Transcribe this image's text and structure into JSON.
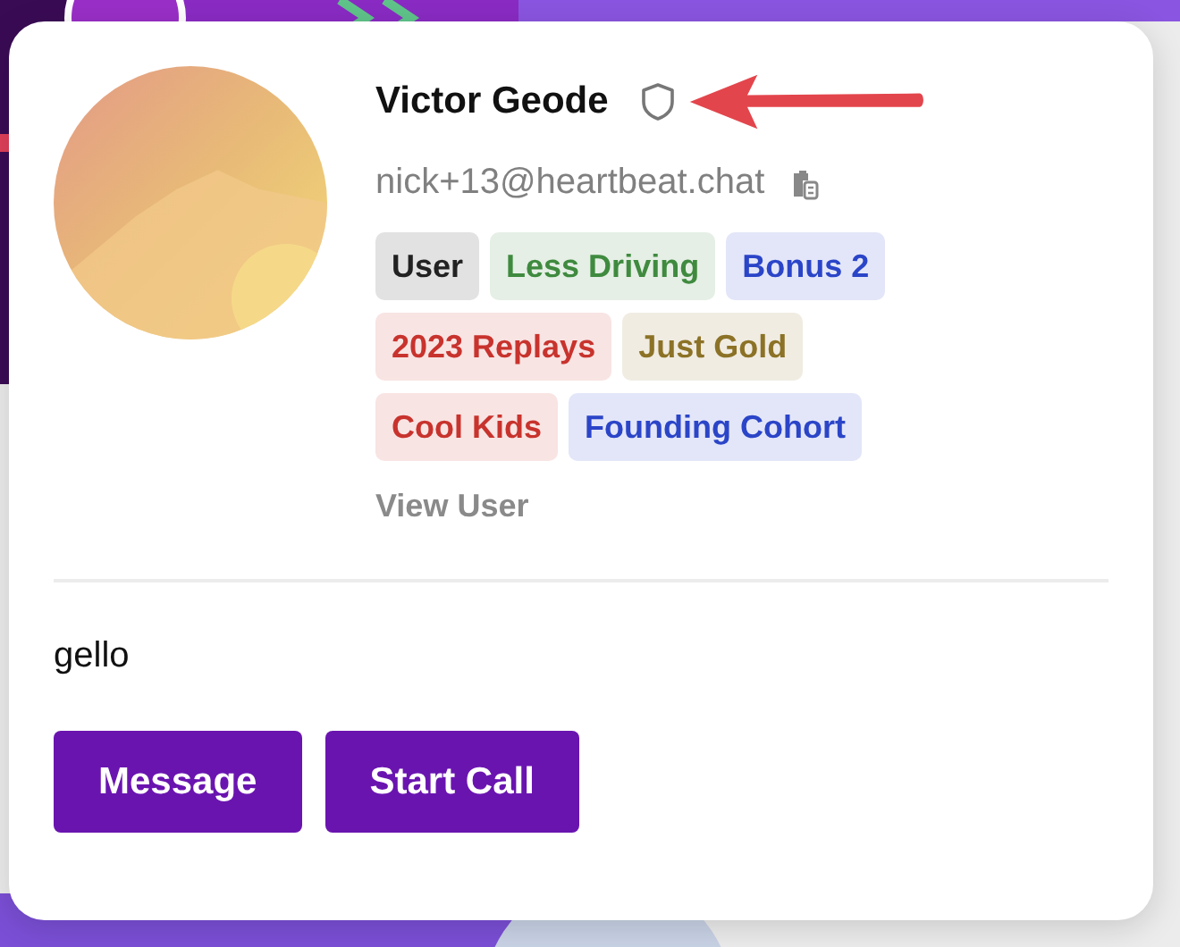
{
  "profile": {
    "name": "Victor Geode",
    "email": "nick+13@heartbeat.chat",
    "tags": [
      {
        "label": "User",
        "color": "#222222"
      },
      {
        "label": "Less Driving",
        "color": "#3f8a3f"
      },
      {
        "label": "Bonus 2",
        "color": "#2b45c8"
      },
      {
        "label": "2023 Replays",
        "color": "#c8332d"
      },
      {
        "label": "Just Gold",
        "color": "#8c7226"
      },
      {
        "label": "Cool Kids",
        "color": "#c8332d"
      },
      {
        "label": "Founding Cohort",
        "color": "#2b45c8"
      }
    ],
    "link": "View User",
    "bio": "gello",
    "buttons": [
      "Message",
      "Start Call"
    ]
  }
}
